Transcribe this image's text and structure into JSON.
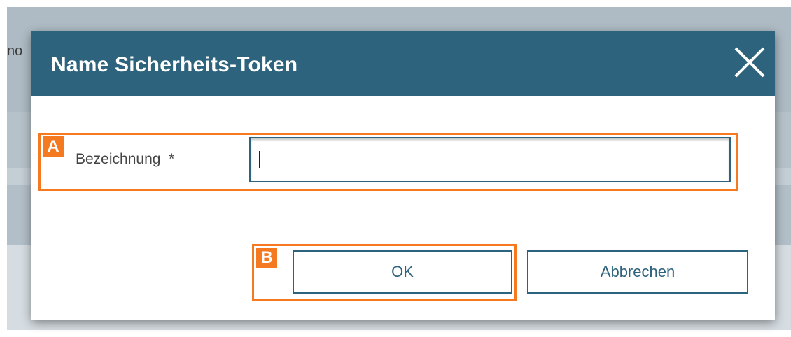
{
  "background": {
    "partial_text": "no"
  },
  "dialog": {
    "title": "Name Sicherheits-Token",
    "close_icon": "close-icon",
    "field": {
      "label": "Bezeichnung  *",
      "value": ""
    },
    "buttons": {
      "ok_label": "OK",
      "cancel_label": "Abbrechen"
    },
    "annotations": {
      "a": "A",
      "b": "B"
    }
  },
  "colors": {
    "header": "#2e637d",
    "annotation": "#f47920",
    "button_text": "#2e637d"
  }
}
